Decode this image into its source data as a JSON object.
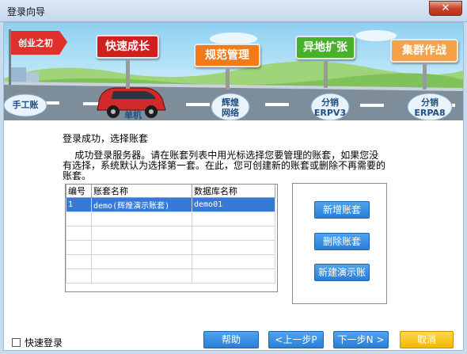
{
  "window": {
    "title": "登录向导",
    "close_glyph": "✕"
  },
  "banner": {
    "flag": "创业之初",
    "signs": [
      "快速成长",
      "规范管理",
      "异地扩张",
      "集群作战"
    ],
    "road_stages": [
      {
        "line1": "手工账",
        "line2": ""
      },
      {
        "line1": "单机",
        "line2": ""
      },
      {
        "line1": "辉煌",
        "line2": "网络"
      },
      {
        "line1": "分销",
        "line2": "ERPV3"
      },
      {
        "line1": "分销",
        "line2": "ERPA8"
      }
    ]
  },
  "main": {
    "heading": "登录成功，选择账套",
    "description": "    成功登录服务器。请在账套列表中用光标选择您要管理的账套，如果您没有选择，系统默认为选择第一套。在此，您可创建新的账套或删除不再需要的账套。"
  },
  "table": {
    "columns": [
      "编号",
      "账套名称",
      "数据库名称"
    ],
    "rows": [
      {
        "id": "1",
        "name": "demo(辉煌演示账套)",
        "db": "demo01"
      }
    ]
  },
  "side_buttons": {
    "new": "新增账套",
    "delete": "删除账套",
    "new_demo": "新建演示账套"
  },
  "footer": {
    "quick_login": "快速登录",
    "help": "帮助",
    "prev": "<上一步P",
    "next": "下一步N >",
    "cancel": "取消"
  }
}
